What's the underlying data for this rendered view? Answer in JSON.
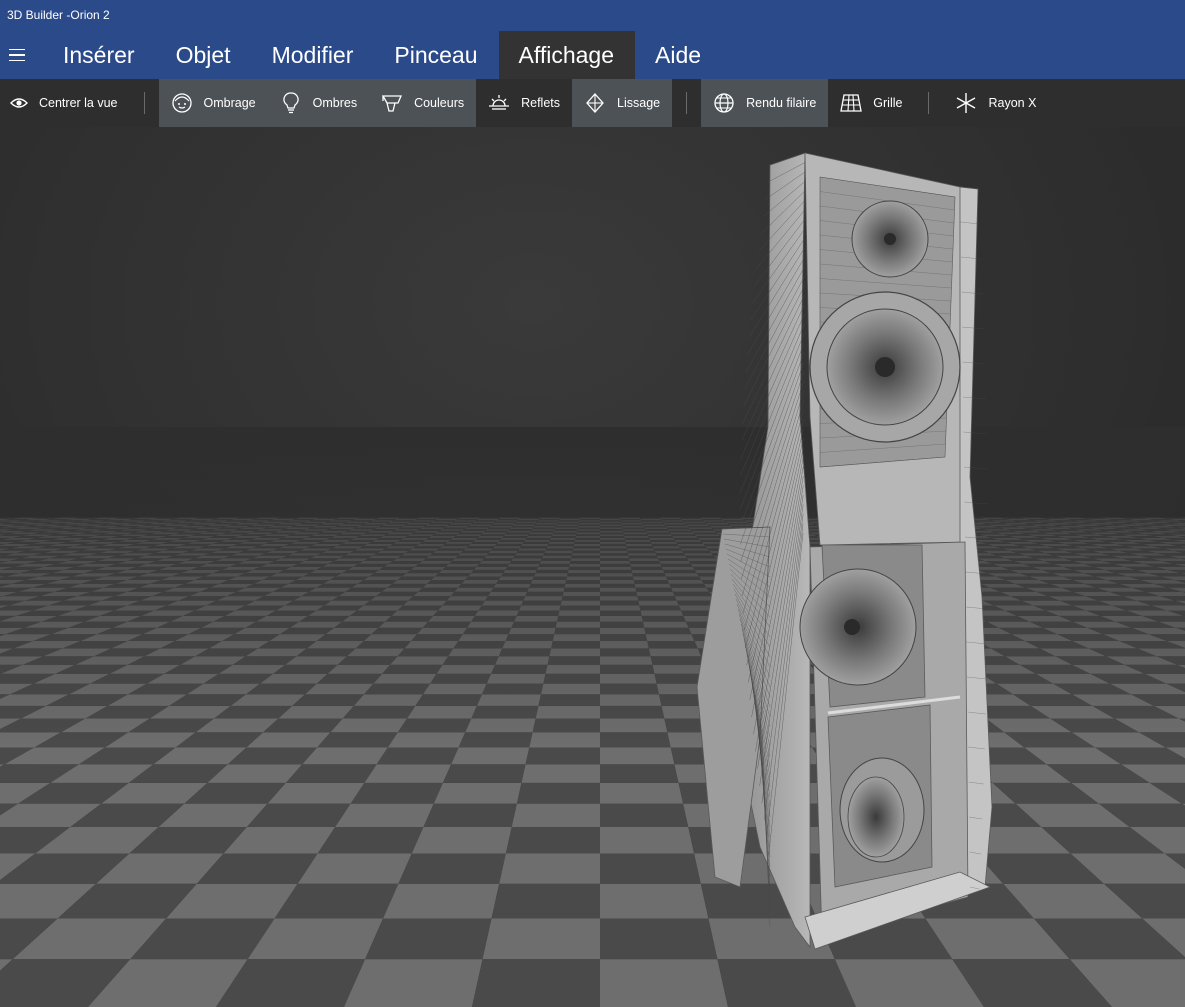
{
  "window": {
    "title": "3D Builder -Orion 2"
  },
  "menu": {
    "tabs": [
      {
        "label": "Insérer"
      },
      {
        "label": "Objet"
      },
      {
        "label": "Modifier"
      },
      {
        "label": "Pinceau"
      },
      {
        "label": "Affichage",
        "active": true
      },
      {
        "label": "Aide"
      }
    ]
  },
  "toolbar": {
    "center_view": "Centrer la vue",
    "shading": "Ombrage",
    "shadows": "Ombres",
    "colors": "Couleurs",
    "reflections": "Reflets",
    "smoothing": "Lissage",
    "wireframe": "Rendu filaire",
    "grid": "Grille",
    "xray": "Rayon X"
  },
  "theme": {
    "titlebar": "#2b4a8a",
    "toolbar": "#2e2e2e",
    "toggle_on": "#4d5256",
    "floor_light": "#6e6e6e",
    "floor_dark": "#4a4a4a"
  },
  "icons": [
    "menu-icon",
    "eye-icon",
    "face-icon",
    "lightbulb-icon",
    "paint-bucket-icon",
    "sunrise-icon",
    "diamond-icon",
    "globe-icon",
    "grid-icon",
    "asterisk-icon"
  ]
}
